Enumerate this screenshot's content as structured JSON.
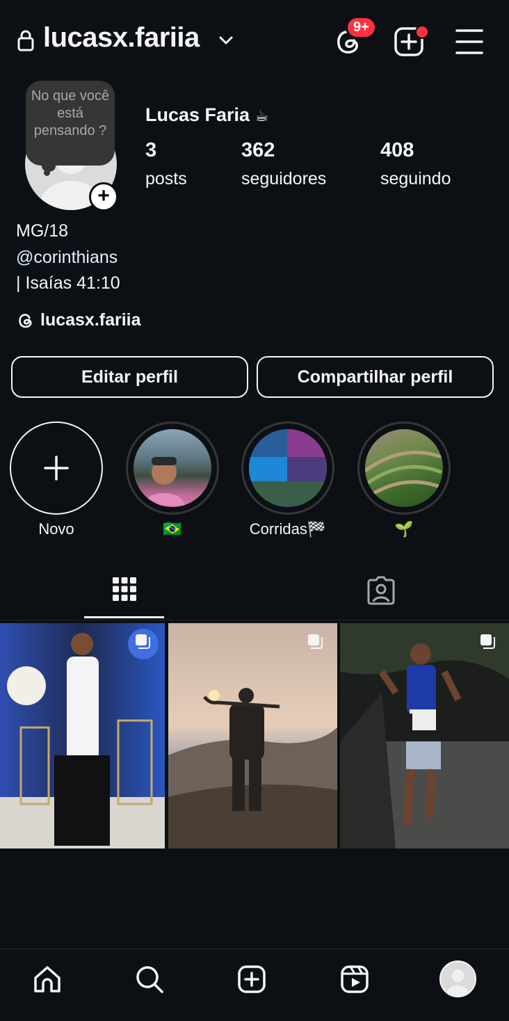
{
  "header": {
    "username": "lucasx.fariia",
    "notif_badge": "9+",
    "colors": {
      "badge": "#ff3040",
      "background": "#0c1014"
    }
  },
  "profile": {
    "note_text": "No que você está pensando ?",
    "full_name": "Lucas Faria",
    "name_emoji": "☕",
    "stats": [
      {
        "value": "3",
        "label": "posts"
      },
      {
        "value": "362",
        "label": "seguidores"
      },
      {
        "value": "408",
        "label": "seguindo"
      }
    ],
    "bio": {
      "line1": "MG/18",
      "line2_link": "@corinthians",
      "line3": "| Isaías 41:10"
    },
    "threads_handle": "lucasx.fariia"
  },
  "buttons": {
    "edit": "Editar perfil",
    "share": "Compartilhar perfil"
  },
  "highlights": [
    {
      "label": "Novo",
      "icon": "plus-icon"
    },
    {
      "label": "🇧🇷",
      "icon": "photo"
    },
    {
      "label": "Corridas🏁",
      "icon": "photo"
    },
    {
      "label": "🌱",
      "icon": "photo"
    }
  ],
  "tabs": [
    {
      "name": "grid",
      "icon": "grid-icon",
      "active": true
    },
    {
      "name": "tagged",
      "icon": "tagged-person-icon",
      "active": false
    }
  ],
  "posts": [
    {
      "description_icon": "multi-photo-icon"
    },
    {
      "description_icon": "multi-photo-icon"
    },
    {
      "description_icon": "multi-photo-icon"
    }
  ],
  "bottom_nav": [
    {
      "icon": "home-icon"
    },
    {
      "icon": "search-icon"
    },
    {
      "icon": "create-icon"
    },
    {
      "icon": "reels-icon"
    },
    {
      "icon": "profile-avatar"
    }
  ]
}
